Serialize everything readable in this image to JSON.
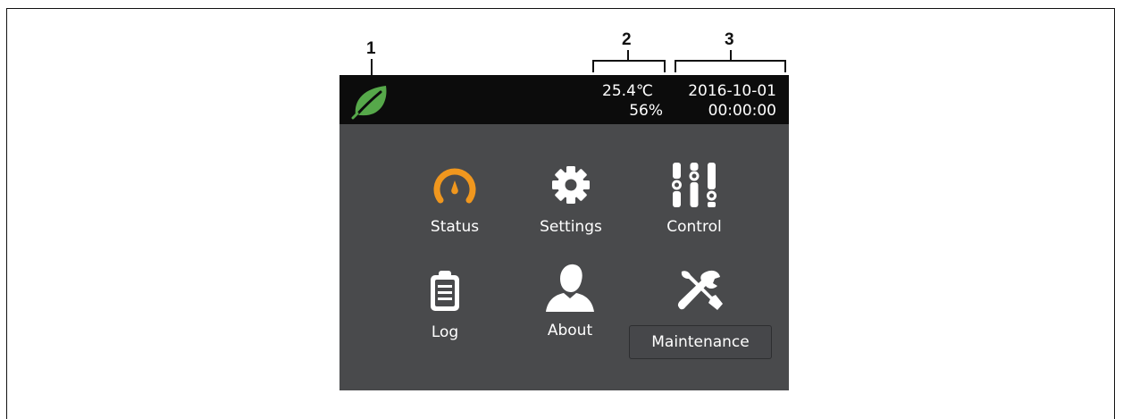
{
  "callouts": [
    {
      "number": "1"
    },
    {
      "number": "2"
    },
    {
      "number": "3"
    }
  ],
  "status_bar": {
    "logo_icon": "leaf-icon",
    "logo_color": "#56a84a",
    "temperature": "25.4℃",
    "humidity": "56%",
    "date": "2016-10-01",
    "time": "00:00:00"
  },
  "menu": {
    "items": [
      {
        "label": "Status",
        "icon": "gauge-icon",
        "accent": "#f0971e"
      },
      {
        "label": "Settings",
        "icon": "gear-icon"
      },
      {
        "label": "Control",
        "icon": "sliders-icon"
      },
      {
        "label": "Log",
        "icon": "clipboard-icon"
      },
      {
        "label": "About",
        "icon": "user-icon"
      },
      {
        "label": "Maintenance",
        "icon": "tools-icon",
        "selected": true
      }
    ]
  }
}
